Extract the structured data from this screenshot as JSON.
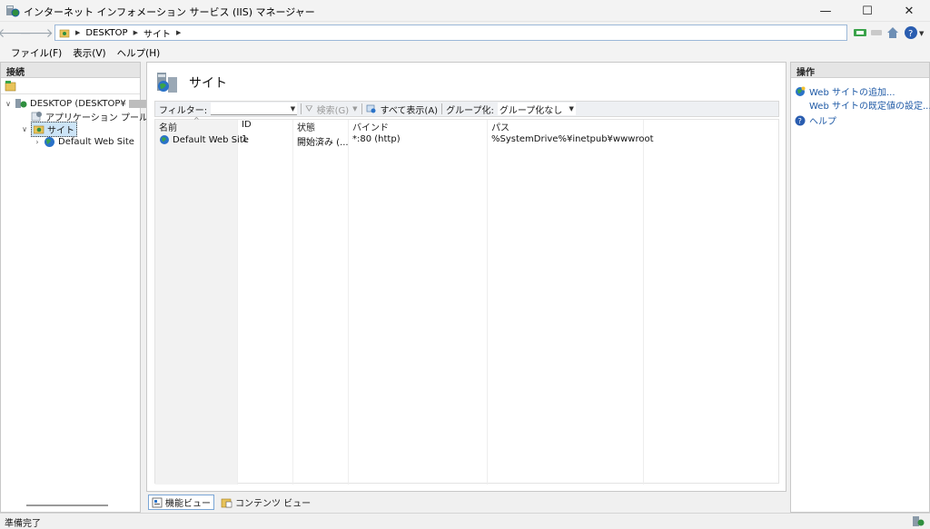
{
  "window": {
    "title": "インターネット インフォメーション サービス (IIS) マネージャー"
  },
  "address": {
    "crumbs": [
      "DESKTOP",
      "サイト"
    ]
  },
  "menu": [
    "ファイル(F)",
    "表示(V)",
    "ヘルプ(H)"
  ],
  "connections": {
    "header": "接続",
    "tree": {
      "server": "DESKTOP (DESKTOP¥",
      "app_pools": "アプリケーション プール",
      "sites": "サイト",
      "default_site": "Default Web Site"
    }
  },
  "center": {
    "title": "サイト",
    "filter_label": "フィルター:",
    "search_label": "検索(G)",
    "show_all_label": "すべて表示(A)",
    "group_label": "グループ化:",
    "group_value": "グループ化なし",
    "columns": [
      "名前",
      "ID",
      "状態",
      "バインド",
      "パス"
    ],
    "rows": [
      [
        "Default Web Site",
        "1",
        "開始済み (...",
        "*:80 (http)",
        "%SystemDrive%¥inetpub¥wwwroot"
      ]
    ],
    "tabs": [
      "機能ビュー",
      "コンテンツ ビュー"
    ]
  },
  "actions": {
    "header": "操作",
    "items": [
      "Web サイトの追加...",
      "Web サイトの既定値の設定...",
      "ヘルプ"
    ]
  },
  "status": {
    "text": "準備完了"
  },
  "colors": {
    "link": "#1f5aa6",
    "selection": "#cce4f7"
  }
}
